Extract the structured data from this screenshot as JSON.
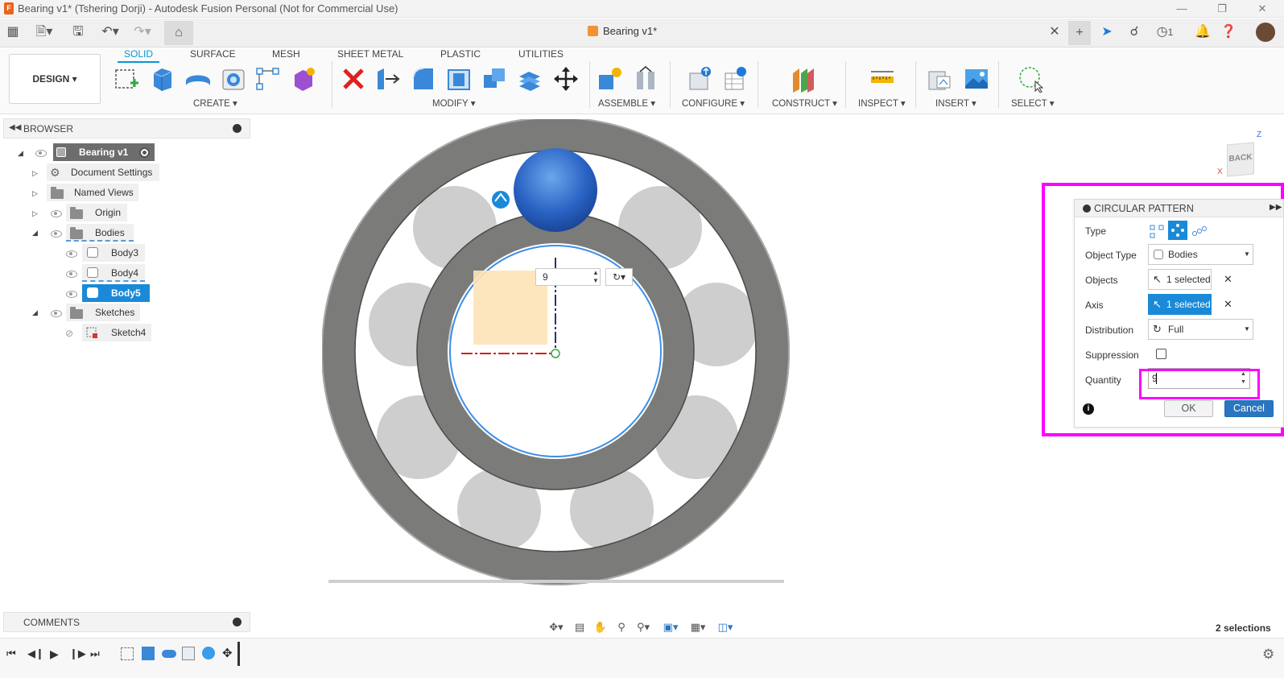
{
  "window": {
    "title": "Bearing v1* (Tshering Dorji) - Autodesk Fusion Personal (Not for Commercial Use)",
    "app_icon_letter": "F"
  },
  "doc_tab": {
    "label": "Bearing v1*",
    "notification_count": "1"
  },
  "workspace": {
    "label": "DESIGN ▾"
  },
  "ribbon_tabs": [
    "SOLID",
    "SURFACE",
    "MESH",
    "SHEET METAL",
    "PLASTIC",
    "UTILITIES"
  ],
  "ribbon_groups": [
    "CREATE ▾",
    "MODIFY ▾",
    "ASSEMBLE ▾",
    "CONFIGURE ▾",
    "CONSTRUCT ▾",
    "INSPECT ▾",
    "INSERT ▾",
    "SELECT ▾"
  ],
  "browser": {
    "title": "BROWSER",
    "items": [
      {
        "label": "Bearing v1"
      },
      {
        "label": "Document Settings"
      },
      {
        "label": "Named Views"
      },
      {
        "label": "Origin"
      },
      {
        "label": "Bodies"
      },
      {
        "label": "Body3"
      },
      {
        "label": "Body4"
      },
      {
        "label": "Body5"
      },
      {
        "label": "Sketches"
      },
      {
        "label": "Sketch4"
      }
    ]
  },
  "comments": {
    "title": "COMMENTS"
  },
  "viewcube": {
    "face": "BACK",
    "axis_z": "Z",
    "axis_x": "X"
  },
  "canvas_input": {
    "quantity_value": "9"
  },
  "dialog": {
    "title": "CIRCULAR PATTERN",
    "rows": {
      "type": "Type",
      "object_type": "Object Type",
      "objects": "Objects",
      "axis": "Axis",
      "distribution": "Distribution",
      "suppression": "Suppression",
      "quantity": "Quantity"
    },
    "object_type_value": "Bodies",
    "objects_value": "1 selected",
    "axis_value": "1 selected",
    "distribution_value": "Full",
    "quantity_value": "9",
    "ok_label": "OK",
    "cancel_label": "Cancel"
  },
  "status": {
    "selections": "2 selections"
  },
  "colors": {
    "accent": "#0696d7",
    "highlight": "#ff00ff",
    "selected_body": "#1f5fbf"
  }
}
